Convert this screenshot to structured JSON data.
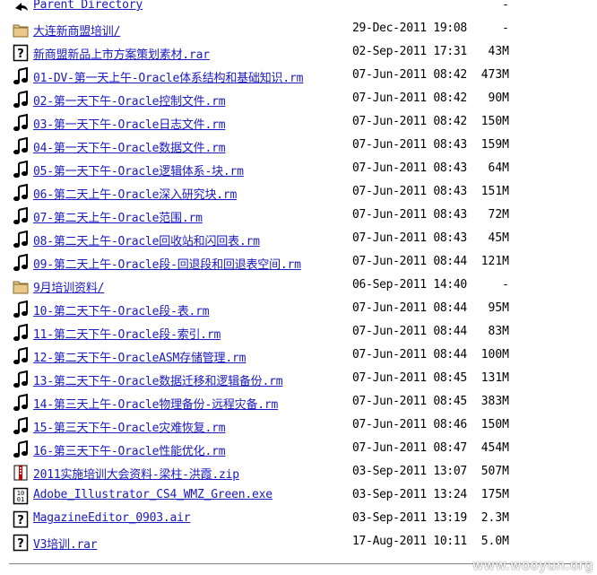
{
  "listing": {
    "parent": {
      "label": "Parent Directory",
      "date": "",
      "size": "-"
    },
    "rows": [
      {
        "icon": "folder-icon",
        "name": "大连新商盟培训/",
        "date": "29-Dec-2011 19:08",
        "size": "-"
      },
      {
        "icon": "unknown-file-icon",
        "name": "新商盟新品上市方案策划素材.rar",
        "date": "02-Sep-2011 17:31",
        "size": "43M"
      },
      {
        "icon": "audio-file-icon",
        "name": "01-DV-第一天上午-Oracle体系结构和基础知识.rm",
        "date": "07-Jun-2011 08:42",
        "size": "473M"
      },
      {
        "icon": "audio-file-icon",
        "name": "02-第一天下午-Oracle控制文件.rm",
        "date": "07-Jun-2011 08:42",
        "size": "90M"
      },
      {
        "icon": "audio-file-icon",
        "name": "03-第一天下午-Oracle日志文件.rm",
        "date": "07-Jun-2011 08:42",
        "size": "150M"
      },
      {
        "icon": "audio-file-icon",
        "name": "04-第一天下午-Oracle数据文件.rm",
        "date": "07-Jun-2011 08:43",
        "size": "159M"
      },
      {
        "icon": "audio-file-icon",
        "name": "05-第一天下午-Oracle逻辑体系-块.rm",
        "date": "07-Jun-2011 08:43",
        "size": "64M"
      },
      {
        "icon": "audio-file-icon",
        "name": "06-第二天上午-Oracle深入研究块.rm",
        "date": "07-Jun-2011 08:43",
        "size": "151M"
      },
      {
        "icon": "audio-file-icon",
        "name": "07-第二天上午-Oracle范围.rm",
        "date": "07-Jun-2011 08:43",
        "size": "72M"
      },
      {
        "icon": "audio-file-icon",
        "name": "08-第二天上午-Oracle回收站和闪回表.rm",
        "date": "07-Jun-2011 08:43",
        "size": "45M"
      },
      {
        "icon": "audio-file-icon",
        "name": "09-第二天上午-Oracle段-回退段和回退表空间.rm",
        "date": "07-Jun-2011 08:44",
        "size": "121M"
      },
      {
        "icon": "folder-icon",
        "name": "9月培训资料/",
        "date": "06-Sep-2011 14:40",
        "size": "-"
      },
      {
        "icon": "audio-file-icon",
        "name": "10-第二天下午-Oracle段-表.rm",
        "date": "07-Jun-2011 08:44",
        "size": "95M"
      },
      {
        "icon": "audio-file-icon",
        "name": "11-第二天下午-Oracle段-索引.rm",
        "date": "07-Jun-2011 08:44",
        "size": "83M"
      },
      {
        "icon": "audio-file-icon",
        "name": "12-第二天下午-OracleASM存储管理.rm",
        "date": "07-Jun-2011 08:44",
        "size": "100M"
      },
      {
        "icon": "audio-file-icon",
        "name": "13-第二天下午-Oracle数据迁移和逻辑备份.rm",
        "date": "07-Jun-2011 08:45",
        "size": "131M"
      },
      {
        "icon": "audio-file-icon",
        "name": "14-第三天上午-Oracle物理备份-远程灾备.rm",
        "date": "07-Jun-2011 08:45",
        "size": "383M"
      },
      {
        "icon": "audio-file-icon",
        "name": "15-第三天下午-Oracle灾难恢复.rm",
        "date": "07-Jun-2011 08:46",
        "size": "150M"
      },
      {
        "icon": "audio-file-icon",
        "name": "16-第三天下午-Oracle性能优化.rm",
        "date": "07-Jun-2011 08:47",
        "size": "454M"
      },
      {
        "icon": "compressed-file-icon",
        "name": "2011实施培训大会资料-梁柱-洪霞.zip",
        "date": "03-Sep-2011 13:07",
        "size": "507M"
      },
      {
        "icon": "binary-file-icon",
        "name": "Adobe_Illustrator_CS4_WMZ_Green.exe",
        "date": "03-Sep-2011 13:24",
        "size": "175M"
      },
      {
        "icon": "unknown-file-icon",
        "name": "MagazineEditor_0903.air",
        "date": "03-Sep-2011 13:19",
        "size": "2.3M"
      },
      {
        "icon": "unknown-file-icon",
        "name": "V3培训.rar",
        "date": "17-Aug-2011 10:11",
        "size": "5.0M"
      }
    ]
  },
  "watermark": "www.wooyun.org",
  "colors": {
    "link": "#1a1ac0",
    "background": "#ffffff",
    "text": "#000000"
  }
}
